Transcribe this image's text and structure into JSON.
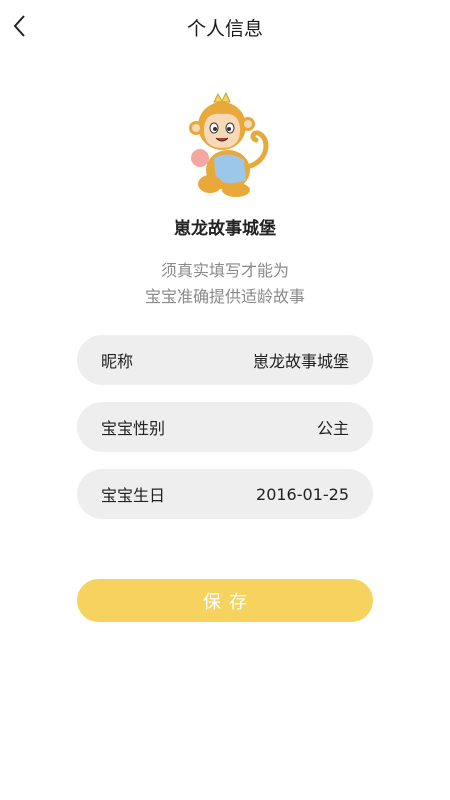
{
  "header": {
    "title": "个人信息",
    "back_icon": "chevron-left-icon"
  },
  "profile": {
    "avatar_icon": "monkey-mascot-icon",
    "nickname": "崽龙故事城堡",
    "hint_line1": "须真实填写才能为",
    "hint_line2": "宝宝准确提供适龄故事"
  },
  "fields": [
    {
      "label": "昵称",
      "value": "崽龙故事城堡"
    },
    {
      "label": "宝宝性别",
      "value": "公主"
    },
    {
      "label": "宝宝生日",
      "value": "2016-01-25"
    }
  ],
  "save": {
    "label": "保存"
  },
  "colors": {
    "accent": "#f5d35e",
    "field_bg": "#eeeeee",
    "hint_text": "#8a8a8a"
  }
}
